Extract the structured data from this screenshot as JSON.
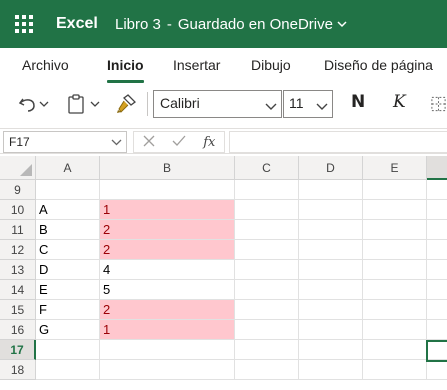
{
  "titlebar": {
    "app_name": "Excel",
    "doc_name": "Libro 3",
    "separator": "-",
    "save_status": "Guardado en OneDrive"
  },
  "ribbon_tabs": [
    {
      "label": "Archivo",
      "active": false
    },
    {
      "label": "Inicio",
      "active": true
    },
    {
      "label": "Insertar",
      "active": false
    },
    {
      "label": "Dibujo",
      "active": false
    },
    {
      "label": "Diseño de página",
      "active": false
    }
  ],
  "commands": {
    "font_name": "Calibri",
    "font_size": "11",
    "bold_label": "N",
    "italic_label": "K"
  },
  "formula_bar": {
    "name_box": "F17",
    "fx_label": "fx",
    "formula": ""
  },
  "columns": [
    "A",
    "B",
    "C",
    "D",
    "E"
  ],
  "selected_row": "17",
  "rows": [
    {
      "num": "9",
      "a": "",
      "b": "",
      "highlight": false
    },
    {
      "num": "10",
      "a": "A",
      "b": "1",
      "highlight": true
    },
    {
      "num": "11",
      "a": "B",
      "b": "2",
      "highlight": true
    },
    {
      "num": "12",
      "a": "C",
      "b": "2",
      "highlight": true
    },
    {
      "num": "13",
      "a": "D",
      "b": "4",
      "highlight": false
    },
    {
      "num": "14",
      "a": "E",
      "b": "5",
      "highlight": false
    },
    {
      "num": "15",
      "a": "F",
      "b": "2",
      "highlight": true
    },
    {
      "num": "16",
      "a": "G",
      "b": "1",
      "highlight": true
    },
    {
      "num": "17",
      "a": "",
      "b": "",
      "highlight": false
    },
    {
      "num": "18",
      "a": "",
      "b": "",
      "highlight": false
    }
  ],
  "colors": {
    "brand": "#217346",
    "highlight_fill": "#ffc7ce",
    "highlight_text": "#9c0006"
  }
}
